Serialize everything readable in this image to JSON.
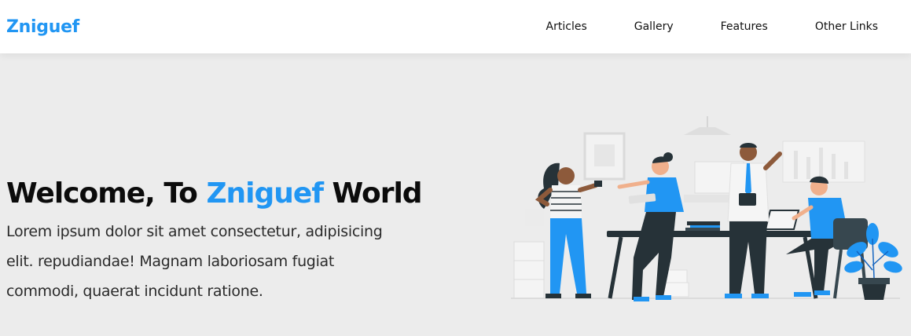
{
  "header": {
    "logo": "Zniguef",
    "nav": [
      {
        "label": "Articles"
      },
      {
        "label": "Gallery"
      },
      {
        "label": "Features"
      },
      {
        "label": "Other Links"
      }
    ]
  },
  "hero": {
    "title_prefix": "Welcome, To ",
    "title_accent": "Zniguef",
    "title_suffix": " World",
    "description": "Lorem ipsum dolor sit amet consectetur, adipisicing elit. repudiandae! Magnam laboriosam fugiat commodi, quaerat incidunt ratione."
  },
  "colors": {
    "accent": "#2196f3",
    "background": "#ececec",
    "header_bg": "#ffffff"
  }
}
